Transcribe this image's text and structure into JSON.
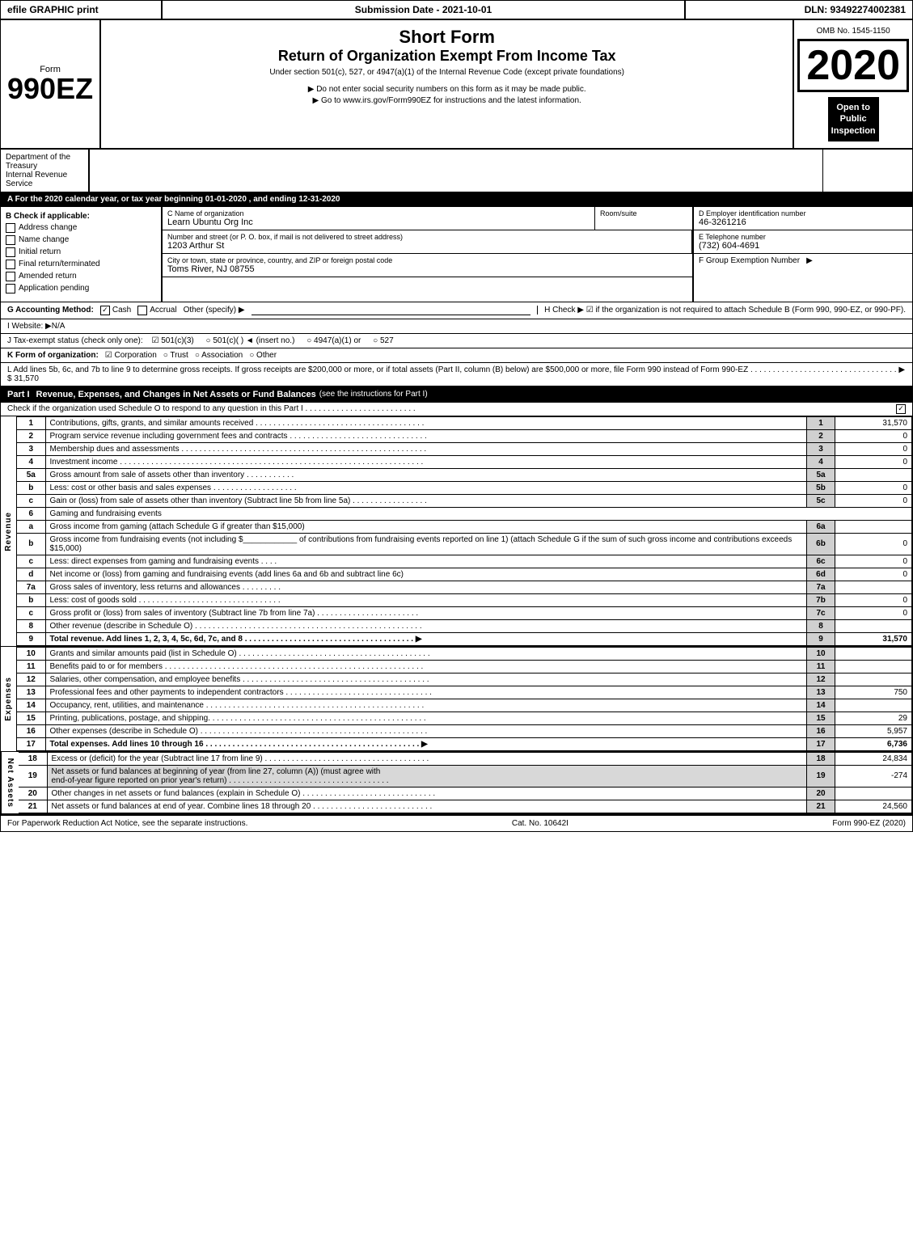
{
  "header": {
    "efile_label": "efile GRAPHIC print",
    "submission_date_label": "Submission Date - 2021-10-01",
    "dln_label": "DLN: 93492274002381"
  },
  "form": {
    "form_label": "Form",
    "form_number": "990EZ",
    "short_form_title": "Short Form",
    "return_title": "Return of Organization Exempt From Income Tax",
    "under_section": "Under section 501(c), 527, or 4947(a)(1) of the Internal Revenue Code (except private foundations)",
    "omb_no": "OMB No. 1545-1150",
    "year": "2020",
    "open_to_public": "Open to\nPublic\nInspection",
    "notice1": "▶ Do not enter social security numbers on this form as it may be made public.",
    "notice2": "▶ Go to www.irs.gov/Form990EZ for instructions and the latest information.",
    "dept_line1": "Department of the",
    "dept_line2": "Treasury",
    "dept_line3": "Internal Revenue",
    "dept_line4": "Service",
    "tax_year_row": "A For the 2020 calendar year, or tax year beginning 01-01-2020 , and ending 12-31-2020",
    "section_b_label": "B Check if applicable:",
    "check_address_change": "Address change",
    "check_name_change": "Name change",
    "check_initial_return": "Initial return",
    "check_final_return": "Final return/terminated",
    "check_amended": "Amended return",
    "check_application_pending": "Application pending",
    "org_name_label": "C Name of organization",
    "org_name": "Learn Ubuntu Org Inc",
    "room_suite_label": "Room/suite",
    "address_label": "Number and street (or P. O. box, if mail is not delivered to street address)",
    "address_value": "1203 Arthur St",
    "city_label": "City or town, state or province, country, and ZIP or foreign postal code",
    "city_value": "Toms River, NJ  08755",
    "ein_label": "D Employer identification number",
    "ein_value": "46-3261216",
    "phone_label": "E Telephone number",
    "phone_value": "(732) 604-4691",
    "group_exempt_label": "F Group Exemption Number",
    "group_exempt_arrow": "▶",
    "accounting_label": "G Accounting Method:",
    "accounting_cash": "Cash",
    "accounting_accrual": "Accrual",
    "accounting_other": "Other (specify) ▶",
    "h_check_label": "H  Check ▶",
    "h_check_desc": "☑ if the organization is not required to attach Schedule B (Form 990, 990-EZ, or 990-PF).",
    "website_label": "I Website: ▶N/A",
    "tax_exempt_label": "J Tax-exempt status (check only one):",
    "tax_exempt_501c3": "☑ 501(c)(3)",
    "tax_exempt_501c": "○ 501(c)(  )  ◄ (insert no.)",
    "tax_exempt_4947": "○ 4947(a)(1) or",
    "tax_exempt_527": "○ 527",
    "k_form_label": "K Form of organization:",
    "k_corporation": "☑ Corporation",
    "k_trust": "○ Trust",
    "k_association": "○ Association",
    "k_other": "○ Other",
    "l_note": "L Add lines 5b, 6c, and 7b to line 9 to determine gross receipts. If gross receipts are $200,000 or more, or if total assets (Part II, column (B) below) are $500,000 or more, file Form 990 instead of Form 990-EZ . . . . . . . . . . . . . . . . . . . . . . . . . . . . . . . . . ▶ $ 31,570",
    "part_i_label": "Part I",
    "part_i_title": "Revenue, Expenses, and Changes in Net Assets or Fund Balances",
    "part_i_see": "(see the instructions for Part I)",
    "check_schedule_o": "Check if the organization used Schedule O to respond to any question in this Part I . . . . . . . . . . . . . . . . . . . . . . . . .",
    "rows": [
      {
        "num": "1",
        "desc": "Contributions, gifts, grants, and similar amounts received . . . . . . . . . . . . . . . . . . . . . . . . . . . .",
        "line_ref": "1",
        "amount": "31,570"
      },
      {
        "num": "2",
        "desc": "Program service revenue including government fees and contracts . . . . . . . . . . . . . . . .",
        "line_ref": "2",
        "amount": "0"
      },
      {
        "num": "3",
        "desc": "Membership dues and assessments . . . . . . . . . . . . . . . . . . . . . . . . . . . . . . . . . . . . . . . . . . .",
        "line_ref": "3",
        "amount": "0"
      },
      {
        "num": "4",
        "desc": "Investment income . . . . . . . . . . . . . . . . . . . . . . . . . . . . . . . . . . . . . . . . . . . . . . . . . . . . . . . . .",
        "line_ref": "4",
        "amount": "0"
      }
    ],
    "row_5a": {
      "num": "5a",
      "desc": "Gross amount from sale of assets other than inventory . . . . . . . .",
      "line_ref": "5a",
      "amount": ""
    },
    "row_5b": {
      "num": "b",
      "desc": "Less: cost or other basis and sales expenses . . . . . . . . . . . . . . .",
      "line_ref": "5b",
      "amount": "0"
    },
    "row_5c": {
      "num": "c",
      "desc": "Gain or (loss) from sale of assets other than inventory (Subtract line 5b from line 5a) . . . . . . .",
      "line_ref": "5c",
      "amount": "0"
    },
    "row_6": {
      "num": "6",
      "desc": "Gaming and fundraising events"
    },
    "row_6a": {
      "num": "a",
      "desc": "Gross income from gaming (attach Schedule G if greater than $15,000)",
      "line_ref": "6a",
      "amount": ""
    },
    "row_6b_desc": "Gross income from fundraising events (not including $__________ of contributions from fundraising events reported on line 1) (attach Schedule G if the sum of such gross income and contributions exceeds $15,000)",
    "row_6b": {
      "num": "b",
      "line_ref": "6b",
      "amount": "0"
    },
    "row_6c": {
      "num": "c",
      "desc": "Less: direct expenses from gaming and fundraising events . . . .",
      "line_ref": "6c",
      "amount": "0"
    },
    "row_6d": {
      "num": "d",
      "desc": "Net income or (loss) from gaming and fundraising events (add lines 6a and 6b and subtract line 6c)",
      "line_ref": "6d",
      "amount": "0"
    },
    "row_7a": {
      "num": "7a",
      "desc": "Gross sales of inventory, less returns and allowances . . . . . . . .",
      "line_ref": "7a",
      "amount": ""
    },
    "row_7b": {
      "num": "b",
      "desc": "Less: cost of goods sold . . . . . . . . . . . . . . . . . . . . . . . . . . . . . . . . .",
      "line_ref": "7b",
      "amount": "0"
    },
    "row_7c": {
      "num": "c",
      "desc": "Gross profit or (loss) from sales of inventory (Subtract line 7b from line 7a) . . . . . . . . . . . . .",
      "line_ref": "7c",
      "amount": "0"
    },
    "row_8": {
      "num": "8",
      "desc": "Other revenue (describe in Schedule O) . . . . . . . . . . . . . . . . . . . . . . . . . . . . . . . . . . . . . . . .",
      "line_ref": "8",
      "amount": ""
    },
    "row_9": {
      "num": "9",
      "desc": "Total revenue. Add lines 1, 2, 3, 4, 5c, 6d, 7c, and 8 . . . . . . . . . . . . . . . . . . . . . . . . . . . . . ▶",
      "line_ref": "9",
      "amount": "31,570"
    },
    "expenses_rows": [
      {
        "num": "10",
        "desc": "Grants and similar amounts paid (list in Schedule O) . . . . . . . . . . . . . . . . . . . . . . . . . . . . . . .",
        "line_ref": "10",
        "amount": ""
      },
      {
        "num": "11",
        "desc": "Benefits paid to or for members . . . . . . . . . . . . . . . . . . . . . . . . . . . . . . . . . . . . . . . . . . . . . .",
        "line_ref": "11",
        "amount": ""
      },
      {
        "num": "12",
        "desc": "Salaries, other compensation, and employee benefits . . . . . . . . . . . . . . . . . . . . . . . . . . . . . .",
        "line_ref": "12",
        "amount": ""
      },
      {
        "num": "13",
        "desc": "Professional fees and other payments to independent contractors . . . . . . . . . . . . . . . . . . . . .",
        "line_ref": "13",
        "amount": "750"
      },
      {
        "num": "14",
        "desc": "Occupancy, rent, utilities, and maintenance . . . . . . . . . . . . . . . . . . . . . . . . . . . . . . . . . . . . .",
        "line_ref": "14",
        "amount": ""
      },
      {
        "num": "15",
        "desc": "Printing, publications, postage, and shipping. . . . . . . . . . . . . . . . . . . . . . . . . . . . . . . . . . . .",
        "line_ref": "15",
        "amount": "29"
      },
      {
        "num": "16",
        "desc": "Other expenses (describe in Schedule O) . . . . . . . . . . . . . . . . . . . . . . . . . . . . . . . . . . . . . . .",
        "line_ref": "16",
        "amount": "5,957"
      },
      {
        "num": "17",
        "desc": "Total expenses. Add lines 10 through 16 . . . . . . . . . . . . . . . . . . . . . . . . . . . . . . . . . . . . . ▶",
        "line_ref": "17",
        "amount": "6,736"
      }
    ],
    "net_assets_rows": [
      {
        "num": "18",
        "desc": "Excess or (deficit) for the year (Subtract line 17 from line 9) . . . . . . . . . . . . . . . . . . . . . . . . . .",
        "line_ref": "18",
        "amount": "24,834"
      },
      {
        "num": "19",
        "desc_line1": "Net assets or fund balances at beginning of year (from line 27, column (A)) (must agree with",
        "desc_line2": "end-of-year figure reported on prior year's return) . . . . . . . . . . . . . . . . . . . . . . . . . . . . . . . . .",
        "line_ref": "19",
        "amount": "-274",
        "grey": true
      },
      {
        "num": "20",
        "desc": "Other changes in net assets or fund balances (explain in Schedule O) . . . . . . . . . . . . . . . . . .",
        "line_ref": "20",
        "amount": ""
      },
      {
        "num": "21",
        "desc": "Net assets or fund balances at end of year. Combine lines 18 through 20 . . . . . . . . . . . . . . .",
        "line_ref": "21",
        "amount": "24,560"
      }
    ],
    "footer_paperwork": "For Paperwork Reduction Act Notice, see the separate instructions.",
    "footer_cat": "Cat. No. 10642I",
    "footer_form": "Form 990-EZ (2020)"
  }
}
